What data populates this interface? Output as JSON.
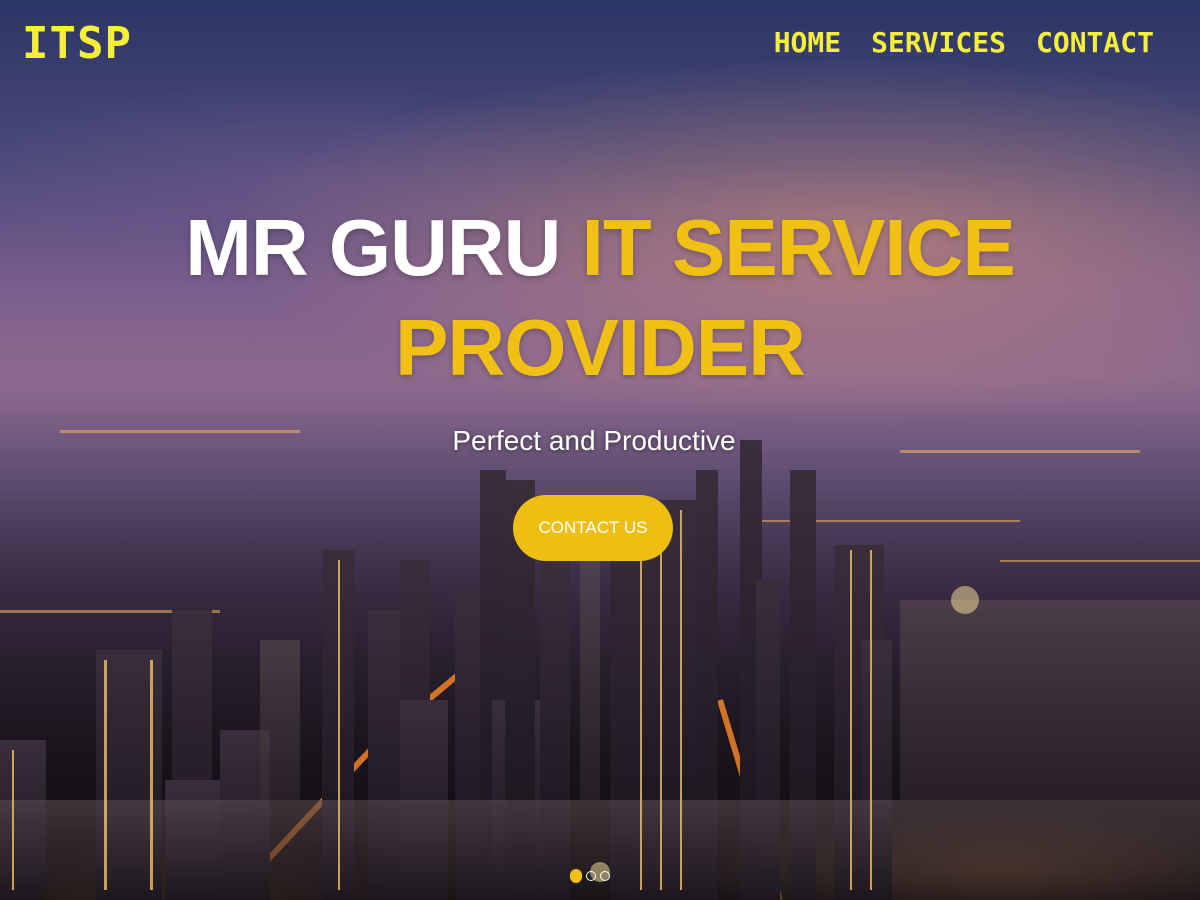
{
  "header": {
    "logo": "ITSP",
    "nav": [
      {
        "label": "HOME"
      },
      {
        "label": "SERVICES"
      },
      {
        "label": "CONTACT"
      }
    ]
  },
  "hero": {
    "headline_white": "MR GURU",
    "headline_gold": "IT SERVICE PROVIDER",
    "tagline": "Perfect and Productive",
    "cta_label": "CONTACT US"
  },
  "carousel": {
    "slide_count": 3,
    "active_index": 0
  },
  "colors": {
    "accent_yellow": "#f5ef3a",
    "gold": "#f0c015",
    "button": "#efbe12"
  }
}
